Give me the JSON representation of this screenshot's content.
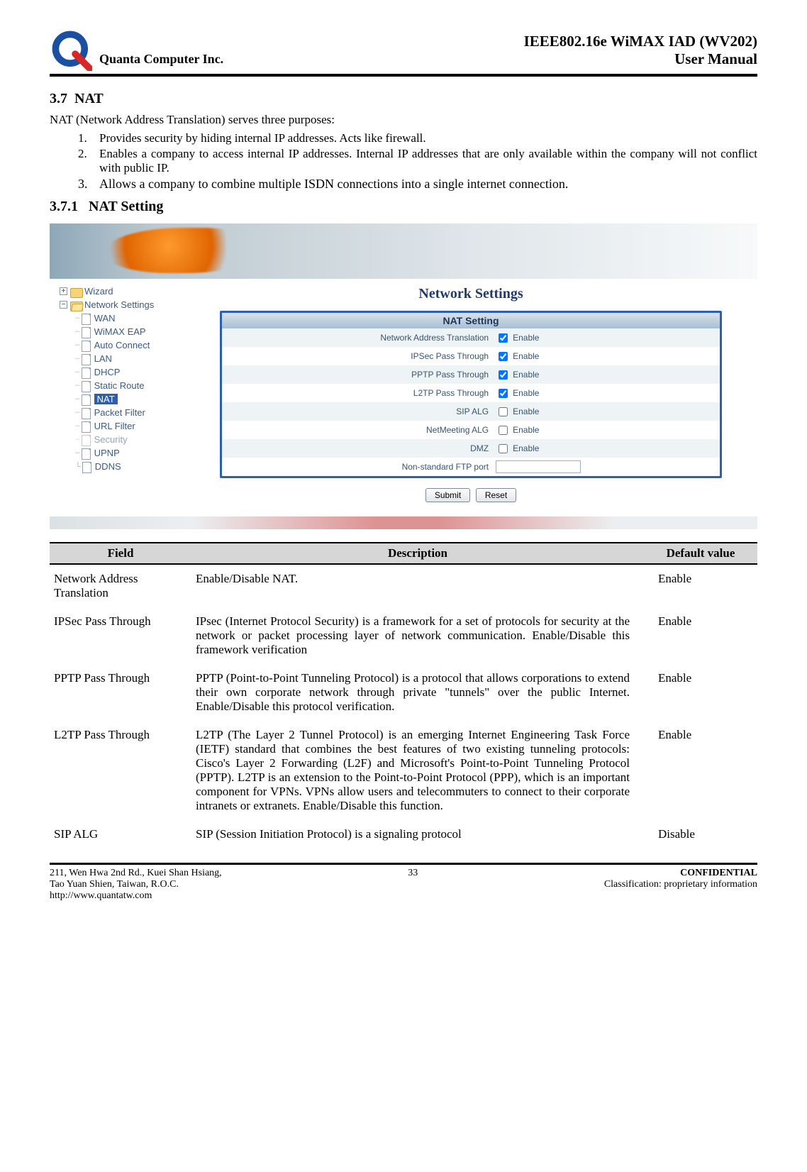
{
  "header": {
    "company": "Quanta  Computer  Inc.",
    "doc_title": "IEEE802.16e  WiMAX  IAD  (WV202)",
    "doc_sub": "User  Manual"
  },
  "section": {
    "num1": "3.7",
    "title1": "NAT",
    "intro": "NAT (Network Address Translation) serves three purposes:",
    "items": [
      "Provides security by hiding internal IP addresses. Acts like firewall.",
      "Enables a company to access internal IP addresses. Internal IP addresses that are only available within the company will not conflict with public IP.",
      "Allows a company to combine multiple ISDN connections into a single internet connection."
    ],
    "num2": "3.7.1",
    "title2": "NAT Setting"
  },
  "tree": {
    "wizard": "Wizard",
    "network_settings": "Network Settings",
    "items": [
      "WAN",
      "WiMAX EAP",
      "Auto Connect",
      "LAN",
      "DHCP",
      "Static Route",
      "NAT",
      "Packet Filter",
      "URL Filter",
      "Security",
      "UPNP",
      "DDNS"
    ]
  },
  "settings": {
    "pane_title": "Network Settings",
    "box_title": "NAT Setting",
    "rows": [
      {
        "label": "Network Address Translation",
        "text": "Enable",
        "checked": true
      },
      {
        "label": "IPSec Pass Through",
        "text": "Enable",
        "checked": true
      },
      {
        "label": "PPTP Pass Through",
        "text": "Enable",
        "checked": true
      },
      {
        "label": "L2TP Pass Through",
        "text": "Enable",
        "checked": true
      },
      {
        "label": "SIP ALG",
        "text": "Enable",
        "checked": false
      },
      {
        "label": "NetMeeting ALG",
        "text": "Enable",
        "checked": false
      },
      {
        "label": "DMZ",
        "text": "Enable",
        "checked": false
      }
    ],
    "ftp_label": "Non-standard FTP port",
    "submit": "Submit",
    "reset": "Reset"
  },
  "table": {
    "h_field": "Field",
    "h_desc": "Description",
    "h_def": "Default value",
    "rows": [
      {
        "field": "Network Address\nTranslation",
        "desc": "Enable/Disable NAT.",
        "def": "Enable"
      },
      {
        "field": "IPSec Pass Through",
        "desc": "IPsec (Internet Protocol Security) is a framework for a set of protocols for security at the network or packet processing layer of network communication. Enable/Disable this framework verification",
        "def": "Enable"
      },
      {
        "field": "PPTP Pass Through",
        "desc": "PPTP (Point-to-Point Tunneling Protocol) is a protocol that allows corporations to extend their own corporate network through private \"tunnels\" over the public Internet. Enable/Disable this protocol verification.",
        "def": "Enable"
      },
      {
        "field": "L2TP Pass Through",
        "desc": "L2TP (The Layer 2 Tunnel Protocol) is an emerging Internet Engineering Task Force (IETF) standard that combines the best features of two existing tunneling protocols: Cisco's Layer 2 Forwarding (L2F) and Microsoft's Point-to-Point Tunneling Protocol (PPTP). L2TP is an extension to the Point-to-Point Protocol (PPP), which is an important component for VPNs. VPNs allow users and telecommuters to connect to their corporate intranets or extranets. Enable/Disable this function.",
        "def": "Enable"
      },
      {
        "field": "SIP ALG",
        "desc": "SIP (Session Initiation Protocol) is a signaling protocol",
        "def": "Disable"
      }
    ]
  },
  "footer": {
    "addr1": "211, Wen Hwa 2nd Rd., Kuei Shan Hsiang,",
    "addr2": "Tao Yuan Shien, Taiwan, R.O.C.",
    "url": "http://www.quantatw.com",
    "page": "33",
    "conf": "CONFIDENTIAL",
    "class": "Classification: proprietary information"
  }
}
